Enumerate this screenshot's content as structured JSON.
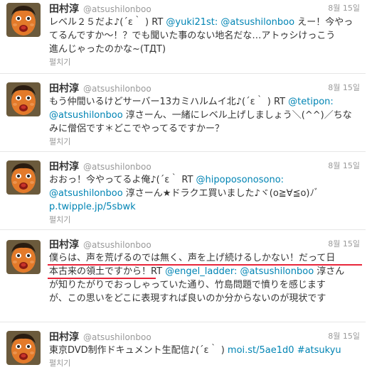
{
  "colors": {
    "link": "#0084b4",
    "meta": "#999999",
    "text": "#333333",
    "highlight": "#e8253a"
  },
  "tweets": [
    {
      "name": "田村淳",
      "handle": "@atsushilonboo",
      "date": "8월 15일",
      "expand": "펼치기",
      "line1": {
        "a": "レベル２５だよ♪(´ε｀ ) RT ",
        "b": "@yuki21st:",
        "c": " ",
        "d": "@atsushilonboo",
        "e": " えー！今やっ"
      },
      "line2": "てるんですか～！？でも聞いた事のない地名だな…アトゥシけっこう",
      "line3": "進んじゃったのかな~(TДT)"
    },
    {
      "name": "田村淳",
      "handle": "@atsushilonboo",
      "date": "8월 15일",
      "expand": "펼치기",
      "line1": {
        "a": "もう仲間いるけどサーバー13カミハルムイ北♪(´ε｀ ) RT ",
        "b": "@tetipon:"
      },
      "line2": {
        "a": "@atsushilonboo",
        "b": " 淳さーん、一緒にレベル上げしましょう＼(^^)／ちな"
      },
      "line3": "みに僧侶です＊どこでやってるですかー？"
    },
    {
      "name": "田村淳",
      "handle": "@atsushilonboo",
      "date": "8월 15일",
      "expand": "펼치기",
      "line1": {
        "a": "おおっ！今やってるよ俺♪(´ε｀ RT ",
        "b": "@hipoposonosono:"
      },
      "line2": {
        "a": "@atsushilonboo",
        "b": " 淳さーん★ドラクエ買いました♪ヾ(o≧∀≦o)ﾉﾞ"
      },
      "line3": {
        "a": "p.twipple.jp/5sbwk"
      }
    },
    {
      "name": "田村淳",
      "handle": "@atsushilonboo",
      "date": "8월 15일",
      "expand": "펼치기",
      "line1": "僕らは、声を荒げるのでは無く、声を上げ続けるしかない！だって日",
      "line2": {
        "a": "本古来の領土ですから！RT ",
        "b": "@engel_ladder:",
        "c": " ",
        "d": "@atsushilonboo",
        "e": " 淳さん"
      },
      "line3": "が知りたがりでおっしゃっていた通り、竹島問題で憤りを感じます",
      "line4": "が、この思いをどこに表現すれば良いのか分からないのが現状です"
    },
    {
      "name": "田村淳",
      "handle": "@atsushilonboo",
      "date": "8월 15일",
      "expand": "펼치기",
      "line1": {
        "a": "東京DVD制作ドキュメント生配信♪(´ε｀ ) ",
        "b": "moi.st/5ae1d0",
        "c": " ",
        "d": "#atsukyu"
      }
    }
  ]
}
